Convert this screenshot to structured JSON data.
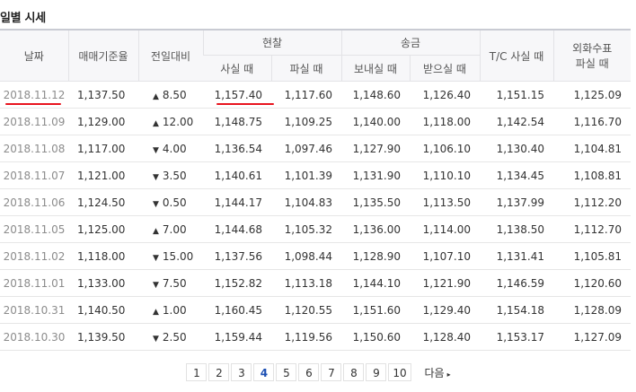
{
  "section_title": "일별 시세",
  "headers": {
    "date": "날짜",
    "base_rate": "매매기준율",
    "change": "전일대비",
    "cash": "현찰",
    "cash_buy": "사실 때",
    "cash_sell": "파실 때",
    "transfer": "송금",
    "transfer_send": "보내실 때",
    "transfer_receive": "받으실 때",
    "tc_buy": "T/C 사실 때",
    "foreign_check_line1": "외화수표",
    "foreign_check_line2": "파실 때"
  },
  "rows": [
    {
      "date": "2018.11.12",
      "base": "1,137.50",
      "dir": "up",
      "arrow": "▲",
      "change": "8.50",
      "cash_buy": "1,157.40",
      "cash_sell": "1,117.60",
      "send": "1,148.60",
      "receive": "1,126.40",
      "tc": "1,151.15",
      "check": "1,125.09"
    },
    {
      "date": "2018.11.09",
      "base": "1,129.00",
      "dir": "up",
      "arrow": "▲",
      "change": "12.00",
      "cash_buy": "1,148.75",
      "cash_sell": "1,109.25",
      "send": "1,140.00",
      "receive": "1,118.00",
      "tc": "1,142.54",
      "check": "1,116.70"
    },
    {
      "date": "2018.11.08",
      "base": "1,117.00",
      "dir": "down",
      "arrow": "▼",
      "change": "4.00",
      "cash_buy": "1,136.54",
      "cash_sell": "1,097.46",
      "send": "1,127.90",
      "receive": "1,106.10",
      "tc": "1,130.40",
      "check": "1,104.81"
    },
    {
      "date": "2018.11.07",
      "base": "1,121.00",
      "dir": "down",
      "arrow": "▼",
      "change": "3.50",
      "cash_buy": "1,140.61",
      "cash_sell": "1,101.39",
      "send": "1,131.90",
      "receive": "1,110.10",
      "tc": "1,134.45",
      "check": "1,108.81"
    },
    {
      "date": "2018.11.06",
      "base": "1,124.50",
      "dir": "down",
      "arrow": "▼",
      "change": "0.50",
      "cash_buy": "1,144.17",
      "cash_sell": "1,104.83",
      "send": "1,135.50",
      "receive": "1,113.50",
      "tc": "1,137.99",
      "check": "1,112.20"
    },
    {
      "date": "2018.11.05",
      "base": "1,125.00",
      "dir": "up",
      "arrow": "▲",
      "change": "7.00",
      "cash_buy": "1,144.68",
      "cash_sell": "1,105.32",
      "send": "1,136.00",
      "receive": "1,114.00",
      "tc": "1,138.50",
      "check": "1,112.70"
    },
    {
      "date": "2018.11.02",
      "base": "1,118.00",
      "dir": "down",
      "arrow": "▼",
      "change": "15.00",
      "cash_buy": "1,137.56",
      "cash_sell": "1,098.44",
      "send": "1,128.90",
      "receive": "1,107.10",
      "tc": "1,131.41",
      "check": "1,105.81"
    },
    {
      "date": "2018.11.01",
      "base": "1,133.00",
      "dir": "down",
      "arrow": "▼",
      "change": "7.50",
      "cash_buy": "1,152.82",
      "cash_sell": "1,113.18",
      "send": "1,144.10",
      "receive": "1,121.90",
      "tc": "1,146.59",
      "check": "1,120.60"
    },
    {
      "date": "2018.10.31",
      "base": "1,140.50",
      "dir": "up",
      "arrow": "▲",
      "change": "1.00",
      "cash_buy": "1,160.45",
      "cash_sell": "1,120.55",
      "send": "1,151.60",
      "receive": "1,129.40",
      "tc": "1,154.18",
      "check": "1,128.09"
    },
    {
      "date": "2018.10.30",
      "base": "1,139.50",
      "dir": "down",
      "arrow": "▼",
      "change": "2.50",
      "cash_buy": "1,159.44",
      "cash_sell": "1,119.56",
      "send": "1,150.60",
      "receive": "1,128.40",
      "tc": "1,153.17",
      "check": "1,127.09"
    }
  ],
  "pagination": {
    "pages": [
      "1",
      "2",
      "3",
      "4",
      "5",
      "6",
      "7",
      "8",
      "9",
      "10"
    ],
    "current": "4",
    "next_label": "다음",
    "next_icon": "▸"
  },
  "colors": {
    "up": "#d0021b",
    "down": "#1c4fb3",
    "annotation": "#e8141e"
  }
}
